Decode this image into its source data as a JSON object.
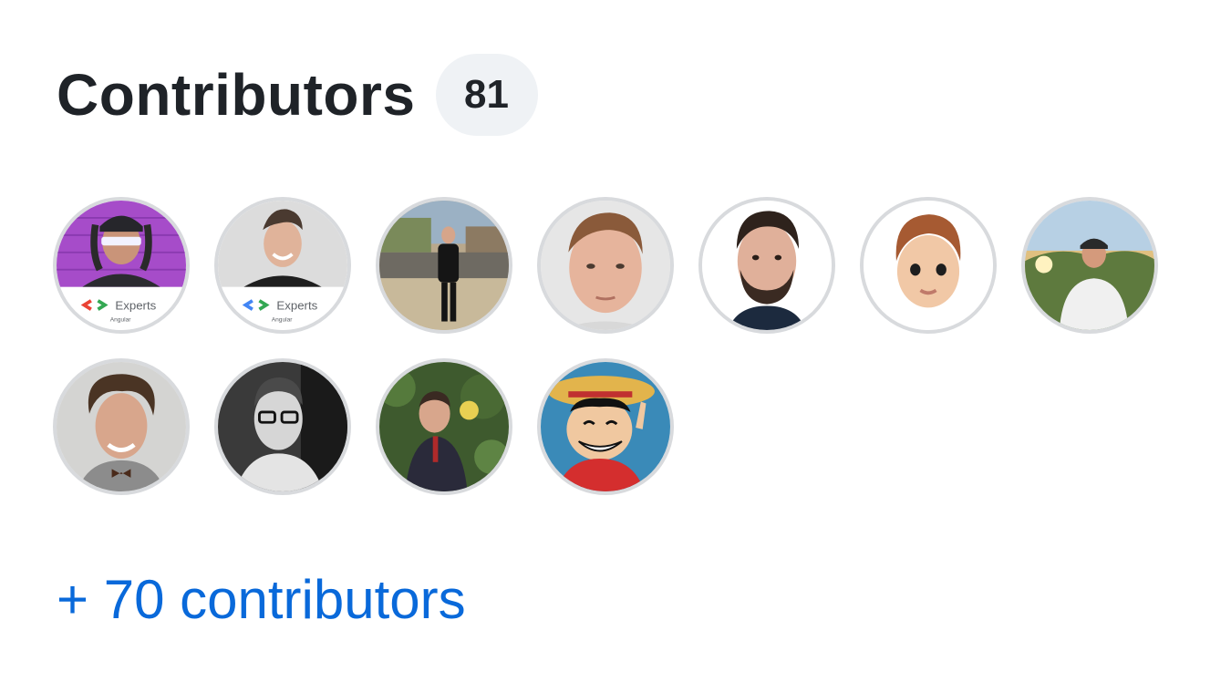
{
  "contributors": {
    "title": "Contributors",
    "count": "81",
    "avatars": [
      {
        "icon": "avatar-gde-neon",
        "badge": "Experts",
        "sub": "Angular"
      },
      {
        "icon": "avatar-gde-smile",
        "badge": "Experts",
        "sub": "Angular"
      },
      {
        "icon": "avatar-street-photo"
      },
      {
        "icon": "avatar-portrait-light"
      },
      {
        "icon": "avatar-portrait-beard"
      },
      {
        "icon": "avatar-memoji"
      },
      {
        "icon": "avatar-sunset-landscape"
      },
      {
        "icon": "avatar-curly-hair"
      },
      {
        "icon": "avatar-glasses-bw"
      },
      {
        "icon": "avatar-tree-fruit"
      },
      {
        "icon": "avatar-anime-straw-hat"
      }
    ],
    "more_link": "+ 70 contributors"
  },
  "colors": {
    "link": "#0969da",
    "count_bg": "#eff2f5",
    "avatar_border": "#d8dadd"
  }
}
